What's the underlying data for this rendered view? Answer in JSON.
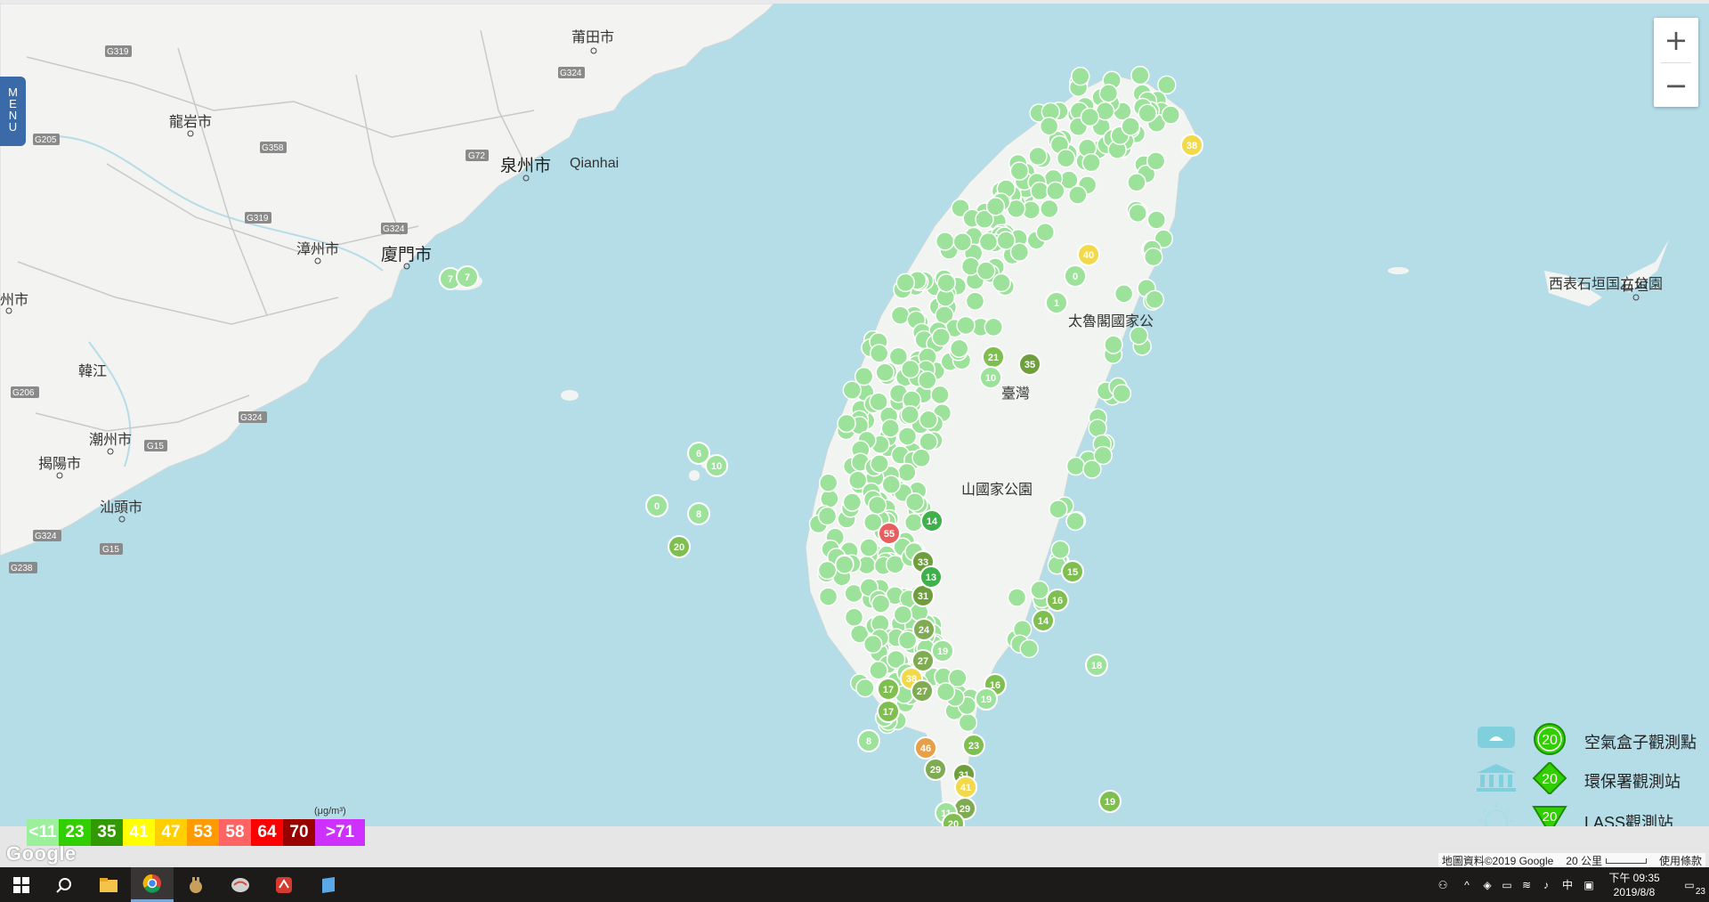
{
  "menu": {
    "label": "MENU",
    "letters": [
      "M",
      "E",
      "N",
      "U"
    ]
  },
  "zoom": {
    "in_label": "+",
    "out_label": "−"
  },
  "map_labels": {
    "cities": [
      {
        "name": "莆田市"
      },
      {
        "name": "龍岩市"
      },
      {
        "name": "泉州市"
      },
      {
        "name": "漳州市"
      },
      {
        "name": "廈門市"
      },
      {
        "name": "州市"
      },
      {
        "name": "潮州市"
      },
      {
        "name": "揭陽市"
      },
      {
        "name": "汕頭市"
      },
      {
        "name": "石垣"
      },
      {
        "name": "西表石垣国立公園"
      },
      {
        "name": "太魯閣國家公"
      },
      {
        "name": "臺灣"
      },
      {
        "name": "山國家公園"
      },
      {
        "name": "Qianhai"
      },
      {
        "name": "韓江"
      }
    ],
    "roads": [
      "G319",
      "G324",
      "G205",
      "G358",
      "G72",
      "G319",
      "G324",
      "G206",
      "G324",
      "G15",
      "G324",
      "G15",
      "G238"
    ]
  },
  "markers": [
    {
      "v": "7"
    },
    {
      "v": "7"
    },
    {
      "v": "6"
    },
    {
      "v": "10"
    },
    {
      "v": "0"
    },
    {
      "v": "8"
    },
    {
      "v": "20"
    },
    {
      "v": "38"
    },
    {
      "v": "40"
    },
    {
      "v": "0"
    },
    {
      "v": "1"
    },
    {
      "v": "21"
    },
    {
      "v": "35"
    },
    {
      "v": "10"
    },
    {
      "v": "55"
    },
    {
      "v": "33"
    },
    {
      "v": "31"
    },
    {
      "v": "13"
    },
    {
      "v": "24"
    },
    {
      "v": "27"
    },
    {
      "v": "38"
    },
    {
      "v": "17"
    },
    {
      "v": "17"
    },
    {
      "v": "27"
    },
    {
      "v": "8"
    },
    {
      "v": "29"
    },
    {
      "v": "23"
    },
    {
      "v": "31"
    },
    {
      "v": "41"
    },
    {
      "v": "29"
    },
    {
      "v": "11"
    },
    {
      "v": "20"
    },
    {
      "v": "19"
    },
    {
      "v": "18"
    },
    {
      "v": "16"
    },
    {
      "v": "15"
    },
    {
      "v": "16"
    },
    {
      "v": "14"
    },
    {
      "v": "14"
    },
    {
      "v": "19"
    },
    {
      "v": "19"
    },
    {
      "v": "46"
    }
  ],
  "station_legend": [
    {
      "label": "空氣盒子觀測點",
      "value": "20"
    },
    {
      "label": "環保署觀測站",
      "value": "20"
    },
    {
      "label": "LASS觀測站",
      "value": "20"
    }
  ],
  "color_scale": {
    "unit": "(μg/m³)",
    "cells": [
      {
        "label": "<11",
        "color": "#9cf09c"
      },
      {
        "label": "23",
        "color": "#31cf00"
      },
      {
        "label": "35",
        "color": "#319a00"
      },
      {
        "label": "41",
        "color": "#ffff00"
      },
      {
        "label": "47",
        "color": "#ffcf00"
      },
      {
        "label": "53",
        "color": "#ff9a00"
      },
      {
        "label": "58",
        "color": "#ff6464"
      },
      {
        "label": "64",
        "color": "#ff0000"
      },
      {
        "label": "70",
        "color": "#990000"
      },
      {
        "label": ">71",
        "color": "#ce30ff"
      }
    ]
  },
  "attribution": {
    "google": "Google",
    "data": "地圖資料©2019 Google",
    "scale": "20 公里",
    "terms": "使用條款"
  },
  "taskbar": {
    "time": "下午 09:35",
    "date": "2019/8/8",
    "ime": "中",
    "notifications": "23"
  },
  "colors": {
    "sea": "#b5dde8",
    "land": "#f3f3f1",
    "marker_green": "#9ce29a",
    "marker_dark": "#7fab52"
  }
}
